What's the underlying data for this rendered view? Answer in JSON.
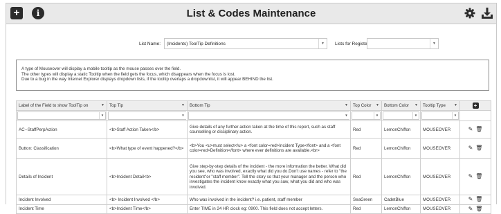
{
  "header": {
    "title": "List & Codes Maintenance",
    "icons": {
      "add": "plus-square-icon",
      "info": "info-icon",
      "settings": "gear-icon",
      "download": "download-icon"
    }
  },
  "selectors": {
    "list_name_label": "List Name:",
    "list_name_value": "(Incidents) ToolTip Definitions",
    "register_label": "Lists for Register:",
    "register_value": ""
  },
  "info": {
    "lines": [
      "A type of Mouseover will display a mobile tooltip as the mouse passes over the field.",
      "The other types will display a static Tooltip when the field gets the focus, which disappears when the focus is lost.",
      "Due to a bug in the way Internet Explorer displays dropdown lists, if the tooltip overlaps a dropdownlist, it will appear BEHIND the list."
    ]
  },
  "table": {
    "columns": [
      "Label of the Field to show ToolTip on",
      "Top Tip",
      "Bottom Tip",
      "Top Color",
      "Bottom Color",
      "Tooltip Type",
      ""
    ],
    "rows": [
      {
        "label": "AC--StaffPerpAction",
        "top_tip": "<b>Staff Action Taken</b>",
        "bottom_tip": "Give details of any further action taken at the time of this report, such as staff counselling or disciplinary action.",
        "top_color": "Red",
        "bottom_color": "LemonChiffon",
        "type": "MOUSEOVER"
      },
      {
        "label": "Button: Classification",
        "top_tip": "<b>What type of event happened?</b>",
        "bottom_tip": "<b>You <u>must select</u> a <font color=red>Incident Type</font> and a <font color=red>Definition</font> where ever definitions are available.<br>",
        "top_color": "Red",
        "bottom_color": "LemonChiffon",
        "type": "MOUSEOVER"
      },
      {
        "label": "Details of Incident",
        "top_tip": "<b>Incident Detail<b>",
        "bottom_tip": "Give step-by-step details of the incident - the more information the better. What did you see, who was involved, exactly what did you do.Don't use names - refer to \"the resident\"or \"staff member\". Tell the story so that your manager and the person who investigates the incident know exactly what you saw, what you did and who was involved.",
        "top_color": "Red",
        "bottom_color": "LemonChiffon",
        "type": "MOUSEOVER"
      },
      {
        "label": "Incident Involved",
        "top_tip": "<b> Incident Involved </b>",
        "bottom_tip": "Who was involved in the incident? i.e. patient, staff member",
        "top_color": "SeaGreen",
        "bottom_color": "CadetBlue",
        "type": "MOUSEOVER"
      },
      {
        "label": "Incident Time",
        "top_tip": "<b>Incident Time</b>",
        "bottom_tip": "Enter TIME in 24 HR clock eg: 0900. This field does not accept letters.",
        "top_color": "Red",
        "bottom_color": "LemonChiffon",
        "type": "MOUSEOVER"
      }
    ]
  }
}
